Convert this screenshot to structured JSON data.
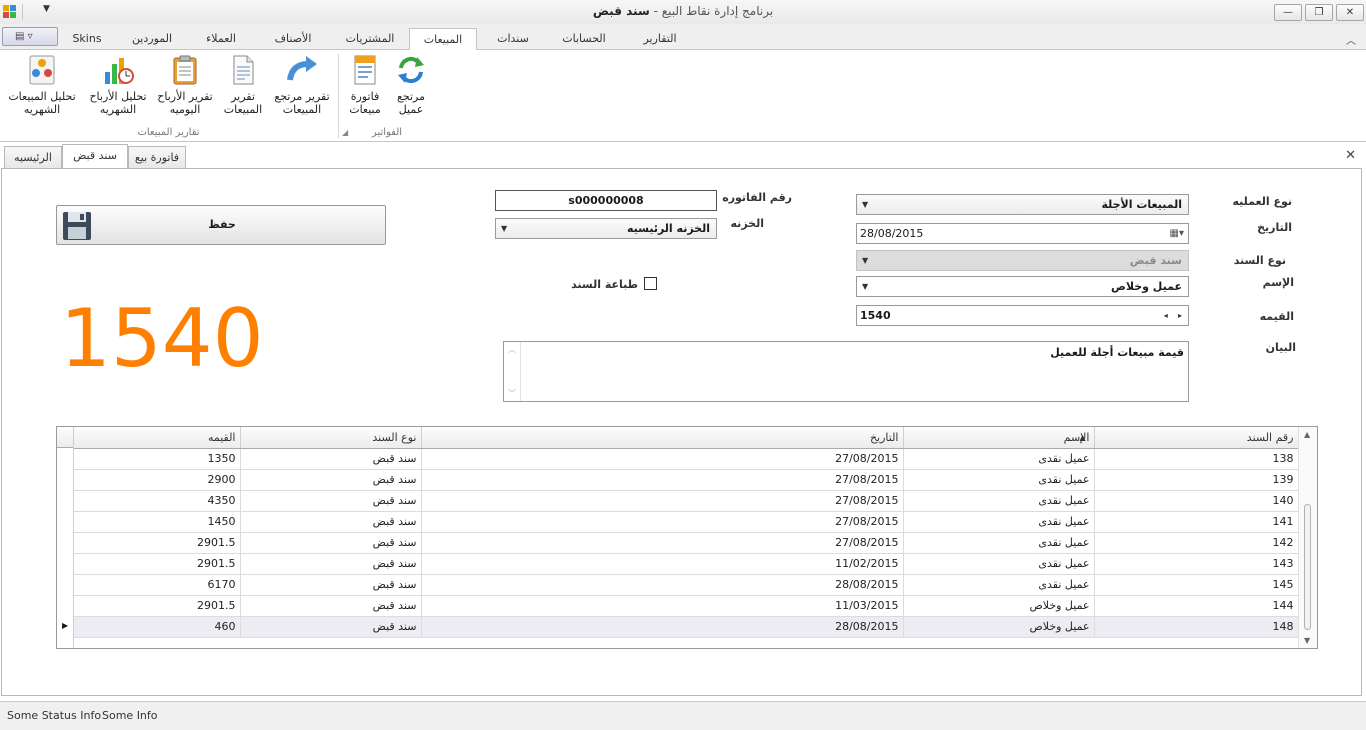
{
  "window": {
    "title_prefix": "برنامج إدارة نقاط البيع - ",
    "title_main": "سند قبض",
    "minimize_glyph": "—",
    "restore_glyph": "❐",
    "close_glyph": "✕"
  },
  "ribbon": {
    "tabs": [
      "التقارير",
      "الحسابات",
      "سندات",
      "المبيعات",
      "المشتريات",
      "الأصناف",
      "العملاء",
      "الموردين",
      "Skins"
    ],
    "active_tab": "المبيعات",
    "groups": [
      {
        "caption": "الفواتير",
        "buttons": [
          {
            "label1": "مرتجع",
            "label2": "عميل",
            "icon": "refresh-arrows-icon"
          },
          {
            "label1": "فاتورة",
            "label2": "مبيعات",
            "icon": "invoice-document-icon"
          }
        ]
      },
      {
        "caption": "تقارير المبيعات",
        "buttons": [
          {
            "label1": "تقرير مرتجع",
            "label2": "المبيعات",
            "icon": "return-arrow-icon"
          },
          {
            "label1": "تقرير",
            "label2": "المبيعات",
            "icon": "report-page-icon"
          },
          {
            "label1": "تقرير الأرباح",
            "label2": "اليوميه",
            "icon": "clipboard-icon"
          },
          {
            "label1": "تحليل الأرباح",
            "label2": "الشهريه",
            "icon": "chart-clock-icon"
          },
          {
            "label1": "تحليل المبيعات",
            "label2": "الشهريه",
            "icon": "analysis-dots-icon"
          }
        ]
      }
    ]
  },
  "doc_tabs": [
    "فاتورة بيع",
    "سند قبض",
    "الرئيسيه"
  ],
  "active_doc_tab": "سند قبض",
  "form": {
    "operation_type_label": "نوع العمليه",
    "operation_type_value": "المبيعات الأجلة",
    "date_label": "التاريخ",
    "date_value": "28/08/2015",
    "voucher_type_label": "نوع السند",
    "voucher_type_value": "سند قبض",
    "name_label": "الإسم",
    "name_value": "عميل وخلاص",
    "amount_label": "القيمه",
    "amount_value": "1540",
    "statement_label": "البيان",
    "statement_value": "قيمة مبيعات أجلة للعميل",
    "invoice_no_label": "رقم الفاتوره",
    "invoice_no_value": "s000000008",
    "store_label": "الخزنه",
    "store_value": "الخزنه الرئيسيه",
    "print_label": "طباعة السند",
    "save_label": "حفظ",
    "big_amount": "1540"
  },
  "grid": {
    "columns": [
      "رقم السند",
      "الإسم",
      "التاريخ",
      "نوع السند",
      "القيمه"
    ],
    "rows": [
      [
        "138",
        "عميل نقدى",
        "27/08/2015",
        "سند قبض",
        "1350"
      ],
      [
        "139",
        "عميل نقدى",
        "27/08/2015",
        "سند قبض",
        "2900"
      ],
      [
        "140",
        "عميل نقدى",
        "27/08/2015",
        "سند قبض",
        "4350"
      ],
      [
        "141",
        "عميل نقدى",
        "27/08/2015",
        "سند قبض",
        "1450"
      ],
      [
        "142",
        "عميل نقدى",
        "27/08/2015",
        "سند قبض",
        "2901.5"
      ],
      [
        "143",
        "عميل نقدى",
        "11/02/2015",
        "سند قبض",
        "2901.5"
      ],
      [
        "145",
        "عميل نقدى",
        "28/08/2015",
        "سند قبض",
        "6170"
      ],
      [
        "144",
        "عميل وخلاص",
        "11/03/2015",
        "سند قبض",
        "2901.5"
      ],
      [
        "148",
        "عميل وخلاص",
        "28/08/2015",
        "سند قبض",
        "460"
      ]
    ],
    "selected_row": 8
  },
  "status": {
    "left": "Some Status Info",
    "right": "Some Info"
  },
  "colors": {
    "big_amount": "#ff7f00"
  }
}
